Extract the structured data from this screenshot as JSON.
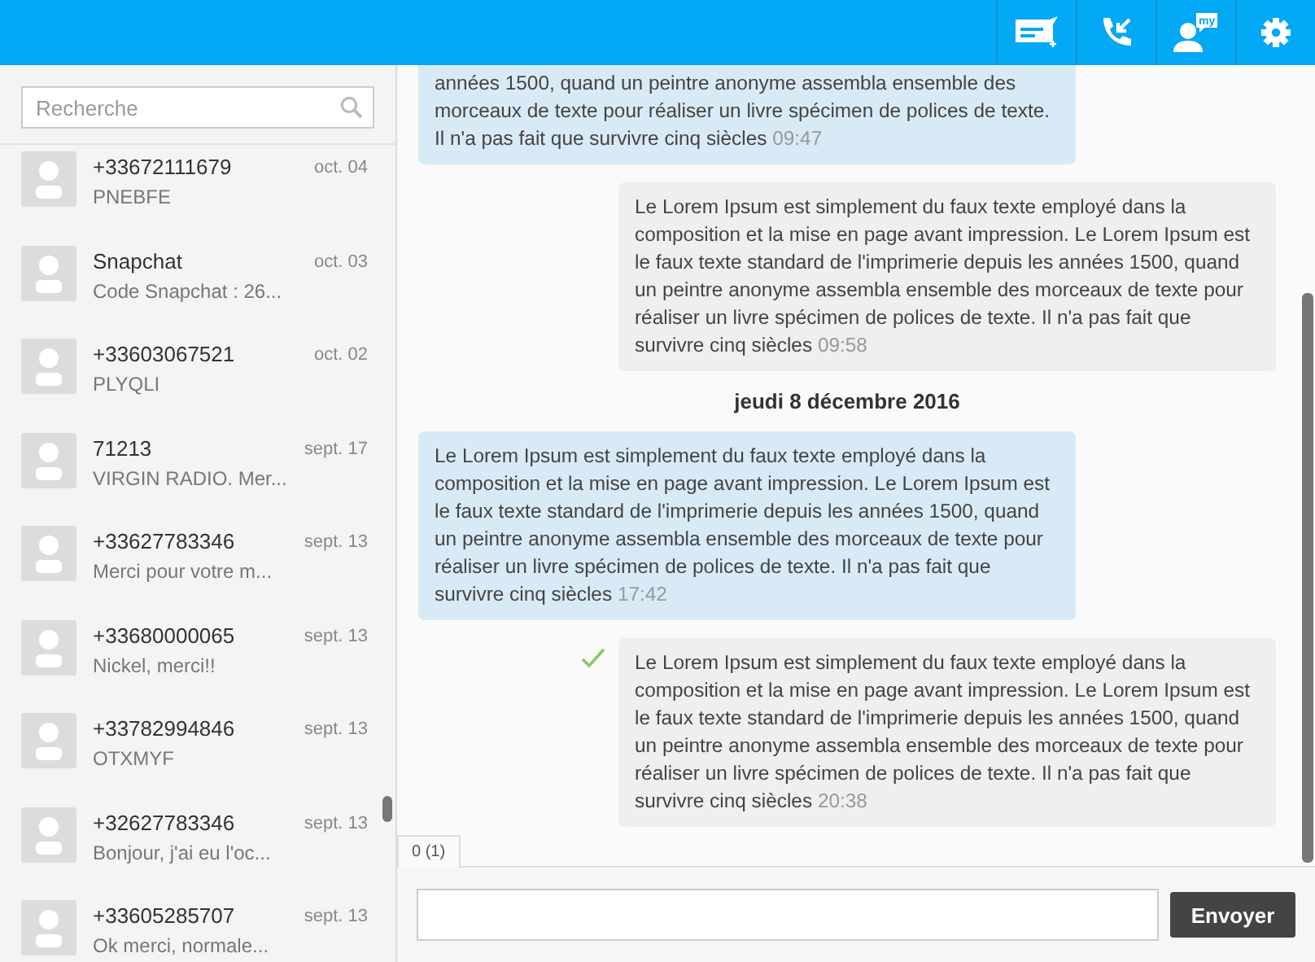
{
  "toolbar": {
    "buttons": [
      {
        "kind": "new-message"
      },
      {
        "kind": "calls"
      },
      {
        "kind": "contacts",
        "badge": "my"
      },
      {
        "kind": "settings"
      }
    ]
  },
  "search": {
    "placeholder": "Recherche"
  },
  "conversations": [
    {
      "name": "+33672111679",
      "preview": "PNEBFE",
      "date": "oct. 04"
    },
    {
      "name": "Snapchat",
      "preview": "Code Snapchat : 26...",
      "date": "oct. 03"
    },
    {
      "name": "+33603067521",
      "preview": "PLYQLI",
      "date": "oct. 02"
    },
    {
      "name": "71213",
      "preview": "VIRGIN RADIO. Mer...",
      "date": "sept. 17"
    },
    {
      "name": "+33627783346",
      "preview": "Merci pour votre m...",
      "date": "sept. 13"
    },
    {
      "name": "+33680000065",
      "preview": "Nickel, merci!!",
      "date": "sept. 13"
    },
    {
      "name": "+33782994846",
      "preview": "OTXMYF",
      "date": "sept. 13"
    },
    {
      "name": "+32627783346",
      "preview": "Bonjour, j'ai eu l'oc...",
      "date": "sept. 13"
    },
    {
      "name": "+33605285707",
      "preview": "Ok merci, normale...",
      "date": "sept. 13"
    }
  ],
  "messages": [
    {
      "kind": "incoming",
      "text": "années 1500, quand un peintre anonyme assembla ensemble des morceaux de texte pour réaliser un livre spécimen de polices de texte. Il n'a pas fait que survivre cinq siècles",
      "time": "09:47",
      "delivered": false
    },
    {
      "kind": "outgoing",
      "text": "Le Lorem Ipsum est simplement du faux texte employé dans la composition et la mise en page avant impression. Le Lorem Ipsum est le faux texte standard de l'imprimerie depuis les années 1500, quand un peintre anonyme assembla ensemble des morceaux de texte pour réaliser un livre spécimen de polices de texte. Il n'a pas fait que survivre cinq siècles",
      "time": "09:58",
      "delivered": false
    },
    {
      "kind": "date",
      "text": "jeudi 8 décembre 2016"
    },
    {
      "kind": "incoming",
      "text": "Le Lorem Ipsum est simplement du faux texte employé dans la composition et la mise en page avant impression. Le Lorem Ipsum est le faux texte standard de l'imprimerie depuis les années 1500, quand un peintre anonyme assembla ensemble des morceaux de texte pour réaliser un livre spécimen de polices de texte. Il n'a pas fait que survivre cinq siècles",
      "time": "17:42",
      "delivered": false
    },
    {
      "kind": "outgoing",
      "text": "Le Lorem Ipsum est simplement du faux texte employé dans la composition et la mise en page avant impression. Le Lorem Ipsum est le faux texte standard de l'imprimerie depuis les années 1500, quand un peintre anonyme assembla ensemble des morceaux de texte pour réaliser un livre spécimen de polices de texte. Il n'a pas fait que survivre cinq siècles",
      "time": "20:38",
      "delivered": true
    }
  ],
  "tabs": [
    {
      "label": "0 (1)",
      "selected": true
    }
  ],
  "composer": {
    "button": "Envoyer"
  }
}
